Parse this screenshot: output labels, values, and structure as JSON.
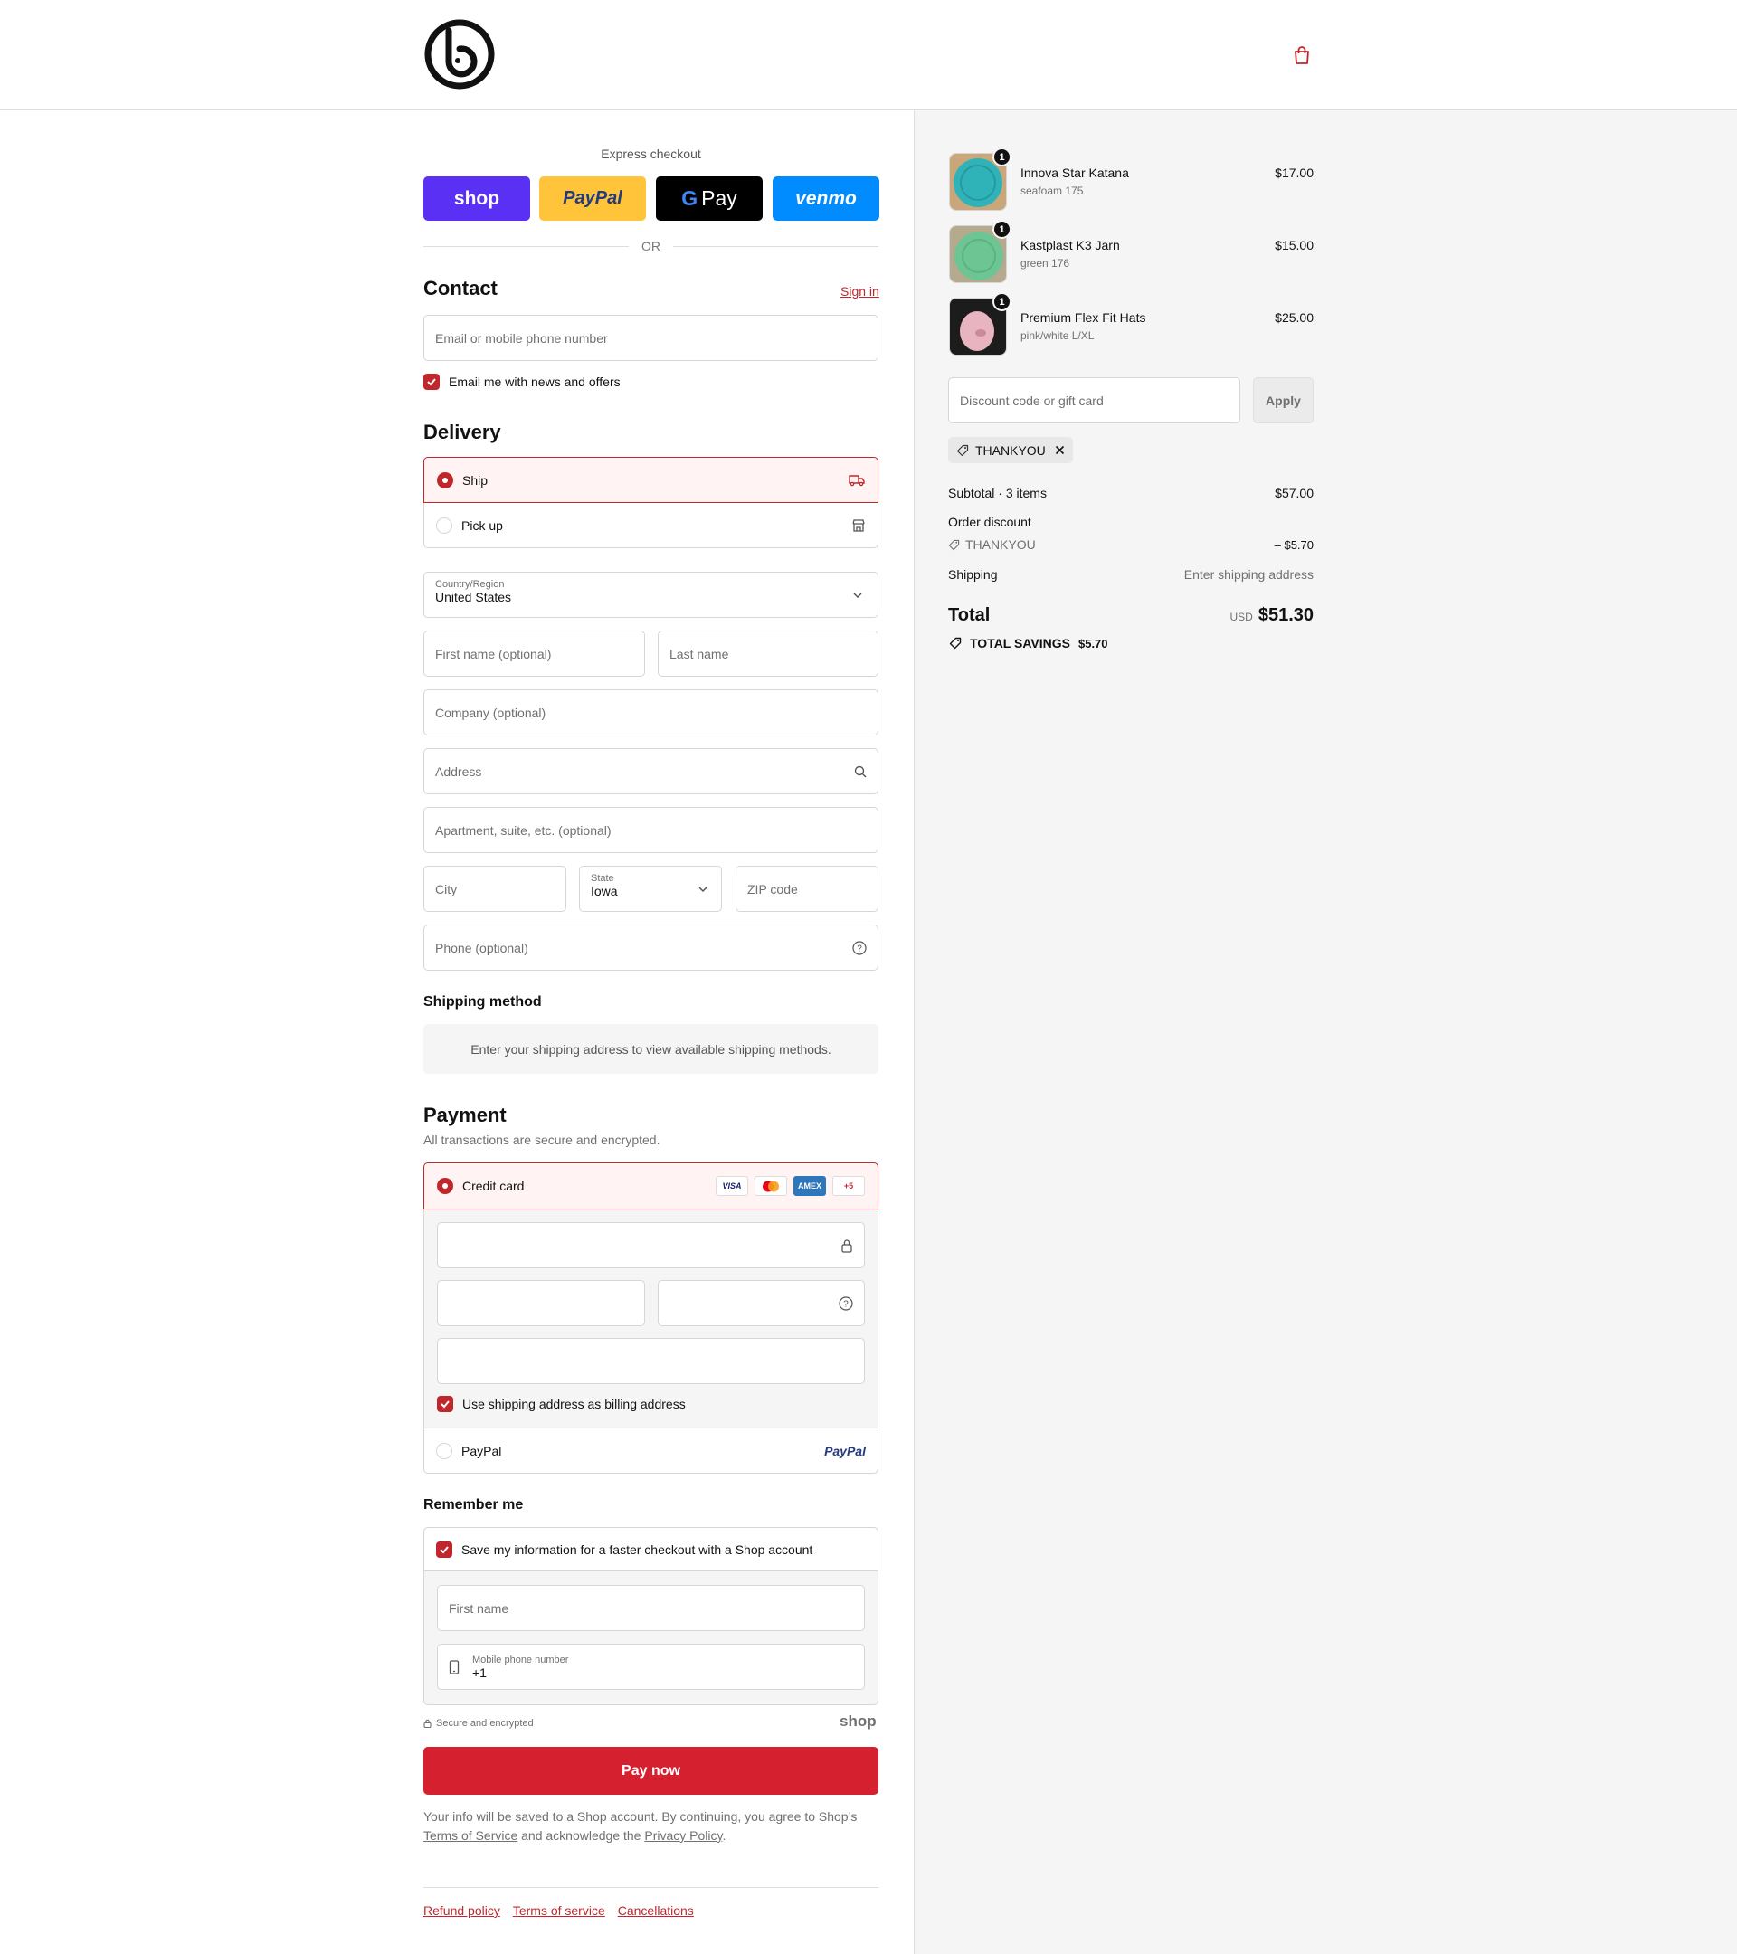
{
  "colors": {
    "accent": "#c0272d",
    "pay_button": "#d5202f",
    "shop_blue": "#5a31f4",
    "paypal_yellow": "#ffc439",
    "venmo_blue": "#008cff"
  },
  "express": {
    "label": "Express checkout",
    "shop": "shop",
    "paypal": "PayPal",
    "gpay": "Pay",
    "venmo": "venmo",
    "or": "OR"
  },
  "contact": {
    "title": "Contact",
    "sign_in": "Sign in",
    "email_placeholder": "Email or mobile phone number",
    "newsletter": "Email me with news and offers",
    "newsletter_checked": true
  },
  "delivery": {
    "title": "Delivery",
    "options": [
      {
        "label": "Ship",
        "selected": true
      },
      {
        "label": "Pick up",
        "selected": false
      }
    ],
    "country_label": "Country/Region",
    "country_value": "United States",
    "first_name": "First name (optional)",
    "last_name": "Last name",
    "company": "Company (optional)",
    "address": "Address",
    "apartment": "Apartment, suite, etc. (optional)",
    "city": "City",
    "state_label": "State",
    "state_value": "Iowa",
    "zip": "ZIP code",
    "phone": "Phone (optional)"
  },
  "shipping_method": {
    "title": "Shipping method",
    "message": "Enter your shipping address to view available shipping methods."
  },
  "payment": {
    "title": "Payment",
    "subtitle": "All transactions are secure and encrypted.",
    "credit_card": "Credit card",
    "cards": [
      "VISA",
      "mastercard",
      "AMEX",
      "+5"
    ],
    "billing_same": "Use shipping address as billing address",
    "paypal": "PayPal",
    "paypal_logo": "PayPal"
  },
  "remember": {
    "title": "Remember me",
    "save_info": "Save my information for a faster checkout with a Shop account",
    "first_name": "First name",
    "mobile_label": "Mobile phone number",
    "mobile_value": "+1",
    "secure": "Secure and encrypted",
    "shop_logo": "shop"
  },
  "pay_now": "Pay now",
  "legal": {
    "text1": "Your info will be saved to a Shop account. By continuing, you agree to Shop’s",
    "tos": "Terms of Service",
    "text2": " and acknowledge the ",
    "privacy": "Privacy Policy",
    "text3": "."
  },
  "footer": {
    "links": [
      "Refund policy",
      "Terms of service",
      "Cancellations"
    ]
  },
  "cart": {
    "items": [
      {
        "name": "Innova Star Katana",
        "variant": "seafoam 175",
        "price": "$17.00",
        "qty": "1",
        "color": "#2fb3b8"
      },
      {
        "name": "Kastplast K3 Jarn",
        "variant": "green 176",
        "price": "$15.00",
        "qty": "1",
        "color": "#6cc592"
      },
      {
        "name": "Premium Flex Fit Hats",
        "variant": "pink/white L/XL",
        "price": "$25.00",
        "qty": "1",
        "color": "#e8b4c0"
      }
    ],
    "discount_placeholder": "Discount code or gift card",
    "apply": "Apply",
    "applied_code": "THANKYOU",
    "subtotal_label": "Subtotal · 3 items",
    "subtotal": "$57.00",
    "order_discount": "Order discount",
    "discount_code": "THANKYOU",
    "discount_amount": "– $5.70",
    "shipping_label": "Shipping",
    "shipping_value": "Enter shipping address",
    "total_label": "Total",
    "currency": "USD",
    "total": "$51.30",
    "savings_label": "TOTAL SAVINGS",
    "savings": "$5.70"
  }
}
